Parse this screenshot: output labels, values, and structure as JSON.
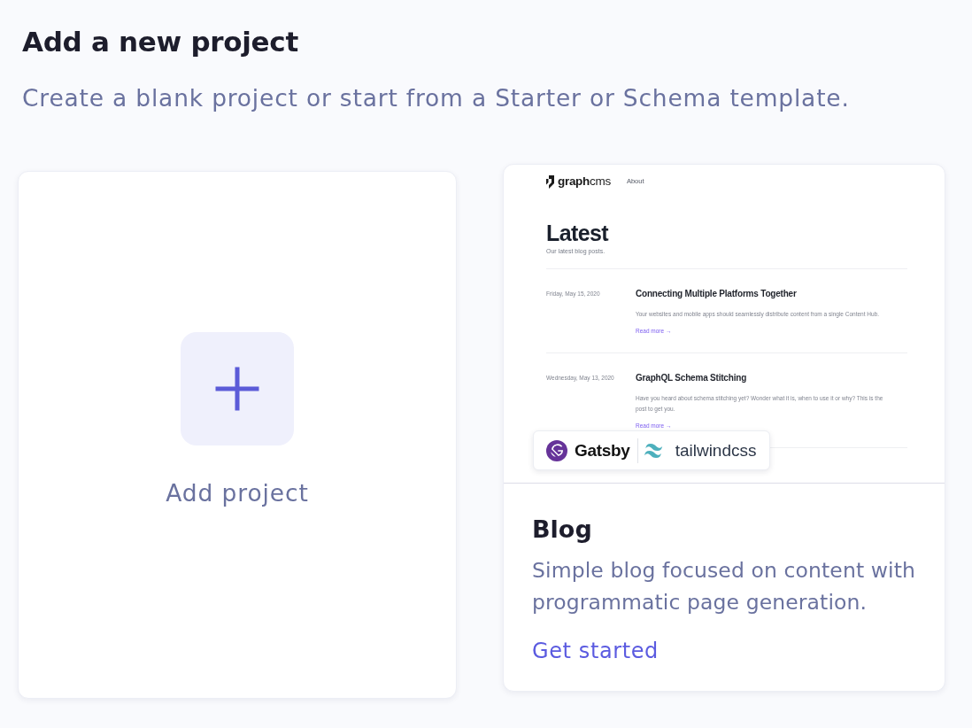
{
  "header": {
    "title": "Add a new project",
    "subtitle": "Create a blank project or start from a Starter or Schema template."
  },
  "cards": [
    {
      "kind": "blank",
      "label": "Add project"
    },
    {
      "kind": "template",
      "preview": {
        "logo": "**graph**cms",
        "nav": [
          "About"
        ],
        "heading": "Latest",
        "tagline": "Our latest blog posts.",
        "posts": [
          {
            "date": "Friday, May 15, 2020",
            "title": "Connecting Multiple Platforms Together",
            "excerpt": "Your websites and mobile apps should seamlessly distribute content from a single Content Hub.",
            "link": "Read more →"
          },
          {
            "date": "Wednesday, May 13, 2020",
            "title": "GraphQL Schema Stitching",
            "excerpt": "Have you heard about schema stitching yet? Wonder what it is, when to use it or why? This is the post to get you.",
            "link": "Read more →"
          }
        ]
      },
      "stack": [
        {
          "kind": "gatsby",
          "name": "Gatsby"
        },
        {
          "kind": "tailwind",
          "name": "tailwindcss"
        }
      ],
      "title": "Blog",
      "description": "Simple blog focused on content with programmatic page generation.",
      "action": "Get started"
    }
  ]
}
